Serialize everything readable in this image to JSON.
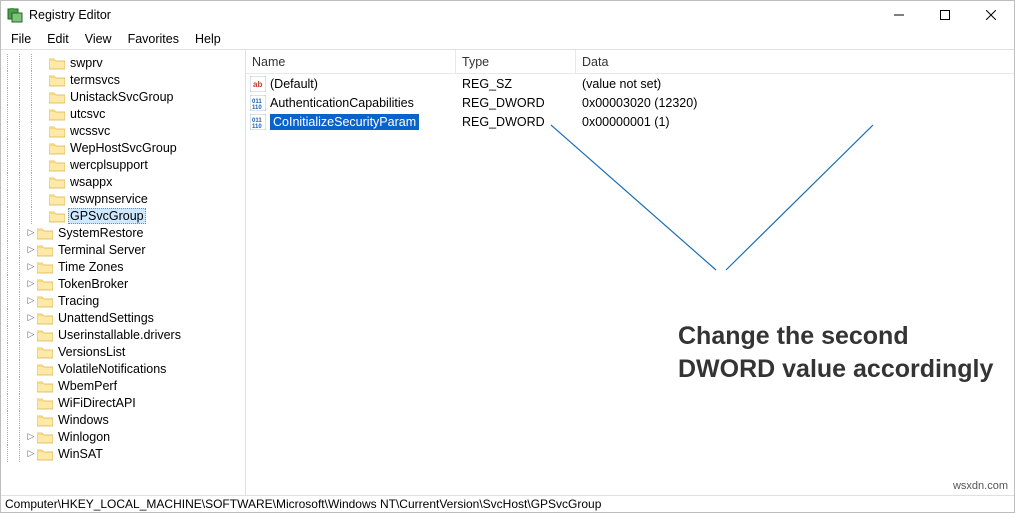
{
  "window": {
    "title": "Registry Editor"
  },
  "menu": {
    "file": "File",
    "edit": "Edit",
    "view": "View",
    "favorites": "Favorites",
    "help": "Help"
  },
  "tree": {
    "items": [
      {
        "depth": 3,
        "label": "swprv",
        "twisty": "none"
      },
      {
        "depth": 3,
        "label": "termsvcs",
        "twisty": "none"
      },
      {
        "depth": 3,
        "label": "UnistackSvcGroup",
        "twisty": "none"
      },
      {
        "depth": 3,
        "label": "utcsvc",
        "twisty": "none"
      },
      {
        "depth": 3,
        "label": "wcssvc",
        "twisty": "none"
      },
      {
        "depth": 3,
        "label": "WepHostSvcGroup",
        "twisty": "none"
      },
      {
        "depth": 3,
        "label": "wercplsupport",
        "twisty": "none"
      },
      {
        "depth": 3,
        "label": "wsappx",
        "twisty": "none"
      },
      {
        "depth": 3,
        "label": "wswpnservice",
        "twisty": "none"
      },
      {
        "depth": 3,
        "label": "GPSvcGroup",
        "twisty": "none",
        "selected": true
      },
      {
        "depth": 2,
        "label": "SystemRestore",
        "twisty": "closed"
      },
      {
        "depth": 2,
        "label": "Terminal Server",
        "twisty": "closed"
      },
      {
        "depth": 2,
        "label": "Time Zones",
        "twisty": "closed"
      },
      {
        "depth": 2,
        "label": "TokenBroker",
        "twisty": "closed"
      },
      {
        "depth": 2,
        "label": "Tracing",
        "twisty": "closed"
      },
      {
        "depth": 2,
        "label": "UnattendSettings",
        "twisty": "closed"
      },
      {
        "depth": 2,
        "label": "Userinstallable.drivers",
        "twisty": "closed"
      },
      {
        "depth": 2,
        "label": "VersionsList",
        "twisty": "none"
      },
      {
        "depth": 2,
        "label": "VolatileNotifications",
        "twisty": "none"
      },
      {
        "depth": 2,
        "label": "WbemPerf",
        "twisty": "none"
      },
      {
        "depth": 2,
        "label": "WiFiDirectAPI",
        "twisty": "none"
      },
      {
        "depth": 2,
        "label": "Windows",
        "twisty": "none"
      },
      {
        "depth": 2,
        "label": "Winlogon",
        "twisty": "closed"
      },
      {
        "depth": 2,
        "label": "WinSAT",
        "twisty": "closed"
      }
    ]
  },
  "list": {
    "headers": {
      "name": "Name",
      "type": "Type",
      "data": "Data"
    },
    "rows": [
      {
        "icon": "sz",
        "name": "(Default)",
        "type": "REG_SZ",
        "data": "(value not set)"
      },
      {
        "icon": "dw",
        "name": "AuthenticationCapabilities",
        "type": "REG_DWORD",
        "data": "0x00003020 (12320)"
      },
      {
        "icon": "dw",
        "name": "CoInitializeSecurityParam",
        "type": "REG_DWORD",
        "data": "0x00000001 (1)",
        "selected": true
      }
    ]
  },
  "statusbar": {
    "path": "Computer\\HKEY_LOCAL_MACHINE\\SOFTWARE\\Microsoft\\Windows NT\\CurrentVersion\\SvcHost\\GPSvcGroup"
  },
  "annotation": {
    "text": "Change the second DWORD value accordingly"
  },
  "watermark": "wsxdn.com"
}
